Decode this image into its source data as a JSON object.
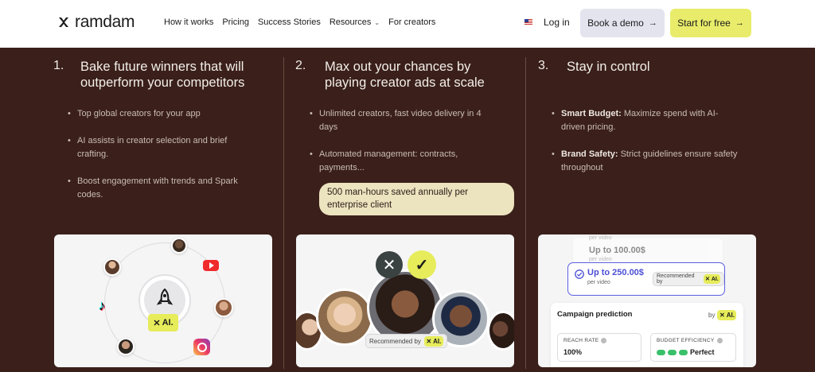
{
  "header": {
    "logo_text": "ramdam",
    "nav": [
      {
        "label": "How it works"
      },
      {
        "label": "Pricing"
      },
      {
        "label": "Success Stories"
      },
      {
        "label": "Resources",
        "has_dropdown": true
      },
      {
        "label": "For creators"
      }
    ],
    "flag_icon": "us-flag-icon",
    "login_label": "Log in",
    "demo_label": "Book a demo",
    "start_label": "Start for free",
    "colors": {
      "demo_bg": "#e4e4ef",
      "start_bg": "#e8ec6a"
    }
  },
  "columns": [
    {
      "number": "1.",
      "title_line1": "Bake future winners that will",
      "title_line2": "outperform your competitors",
      "bullets": [
        {
          "line1": "Top global creators for your app"
        },
        {
          "line1": "AI assists in creator selection and brief",
          "line2": "crafting."
        },
        {
          "line1": "Boost engagement with trends and Spark",
          "line2": "codes."
        }
      ]
    },
    {
      "number": "2.",
      "title_line1": "Max out your chances by",
      "title_line2": "playing creator ads at scale",
      "bullets": [
        {
          "line1": "Unlimited creators, fast video delivery in 4",
          "line2": "days"
        },
        {
          "line1": "Automated management: contracts,",
          "line2": "payments..."
        }
      ],
      "callout_line1": "500 man-hours saved annually per",
      "callout_line2": "enterprise client"
    },
    {
      "number": "3.",
      "title_line1": "Stay in control",
      "bullets": [
        {
          "bold": "Smart Budget:",
          "line1": " Maximize spend with AI-",
          "line2": "driven pricing."
        },
        {
          "bold": "Brand Safety:",
          "line1": " Strict guidelines ensure safety",
          "line2": "throughout"
        }
      ]
    }
  ],
  "cards": {
    "ai_label": "AI.",
    "recommended_label": "Recommended by",
    "icons": [
      "rocket-icon",
      "youtube-icon",
      "tiktok-icon",
      "instagram-icon",
      "x-icon",
      "check-icon"
    ],
    "pricing": {
      "per_video_label": "per video",
      "tier1": "Up to 100.00$",
      "tier2": "Up to 250.00$"
    },
    "prediction": {
      "title": "Campaign prediction",
      "by_label": "by",
      "reach_label": "REACH RATE",
      "reach_value": "100%",
      "budget_label": "BUDGET EFFICIENCY",
      "budget_value": "Perfect",
      "budget_level": 3
    }
  },
  "colors": {
    "background": "#3a1f1a",
    "accent": "#e6ec5a",
    "callout": "#ece3bf",
    "pricing_blue": "#4b4fd6"
  }
}
